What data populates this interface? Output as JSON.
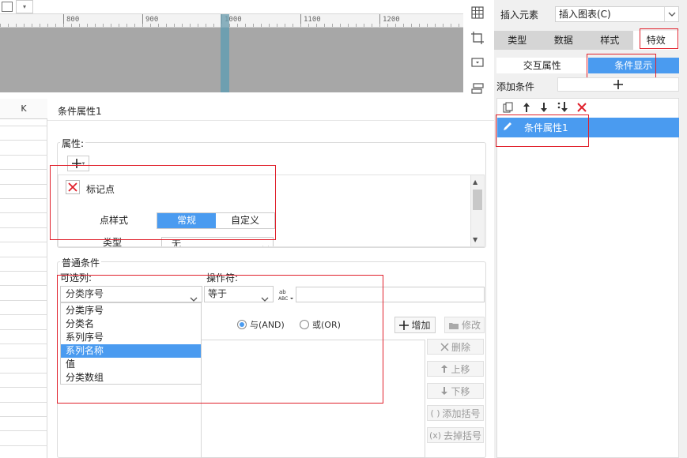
{
  "ruler": {
    "ticks": [
      "800",
      "900",
      "1000",
      "1100",
      "1200"
    ]
  },
  "sheet": {
    "column_header": "K"
  },
  "right_panel": {
    "insert_element_label": "插入元素",
    "insert_element_value": "插入图表(C)",
    "tabs": [
      "类型",
      "数据",
      "样式",
      "特效"
    ],
    "active_tab": "特效",
    "sub_tabs": [
      "交互属性",
      "条件显示"
    ],
    "active_sub_tab": "条件显示",
    "add_condition_label": "添加条件",
    "conditions": [
      "条件属性1"
    ]
  },
  "dialog": {
    "title": "条件属性1",
    "attributes": {
      "group_title": "属性:",
      "marker_label": "标记点",
      "point_style_label": "点样式",
      "point_style_options": [
        "常规",
        "自定义"
      ],
      "point_style_selected": "常规",
      "partial_label": "类型",
      "partial_value": "无"
    },
    "normal_condition": {
      "group_title": "普通条件",
      "column_label": "可选列:",
      "column_value": "分类序号",
      "column_options": [
        "分类序号",
        "分类名",
        "系列序号",
        "系列名称",
        "值",
        "分类数组"
      ],
      "column_highlight": "系列名称",
      "operator_label": "操作符:",
      "operator_value": "等于",
      "value_text": ""
    },
    "logic": {
      "and_label": "与(AND)",
      "or_label": "或(OR)",
      "selected": "and"
    },
    "buttons": {
      "add": "增加",
      "modify": "修改",
      "delete": "删除",
      "move_up": "上移",
      "move_down": "下移",
      "add_bracket": "添加括号",
      "remove_bracket": "去掉括号"
    }
  },
  "colors": {
    "accent": "#4a9bf0",
    "highlight_red": "#e0202b",
    "canvas": "#a7a7a7",
    "marker": "#6e9fb0"
  }
}
